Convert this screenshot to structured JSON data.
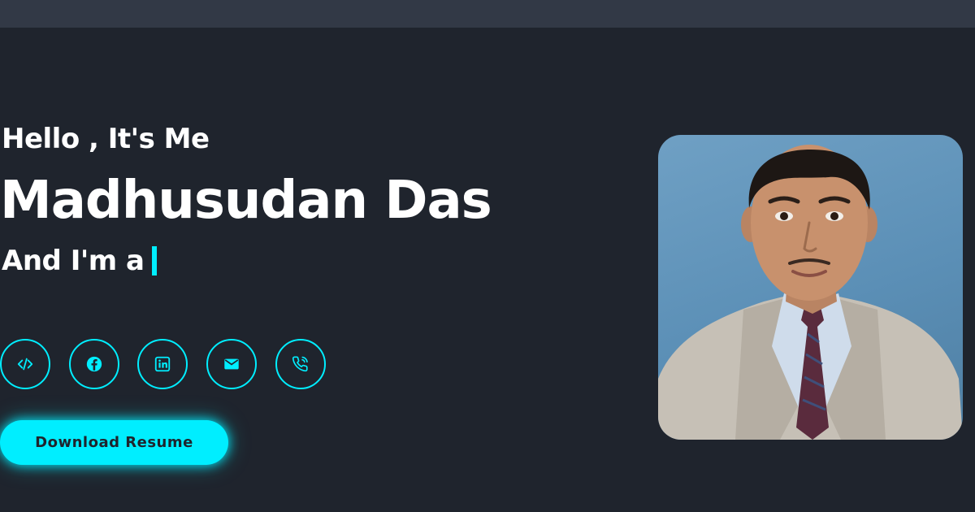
{
  "hero": {
    "greeting": "Hello , It's Me",
    "name": "Madhusudan Das",
    "role_prefix": "And I'm a"
  },
  "socials": [
    {
      "icon": "code-icon"
    },
    {
      "icon": "facebook-icon"
    },
    {
      "icon": "linkedin-icon"
    },
    {
      "icon": "email-icon"
    },
    {
      "icon": "phone-icon"
    }
  ],
  "download_button": "Download Resume",
  "colors": {
    "background": "#1f242d",
    "topbar": "#323946",
    "accent": "#00eeff",
    "text": "#ffffff"
  }
}
